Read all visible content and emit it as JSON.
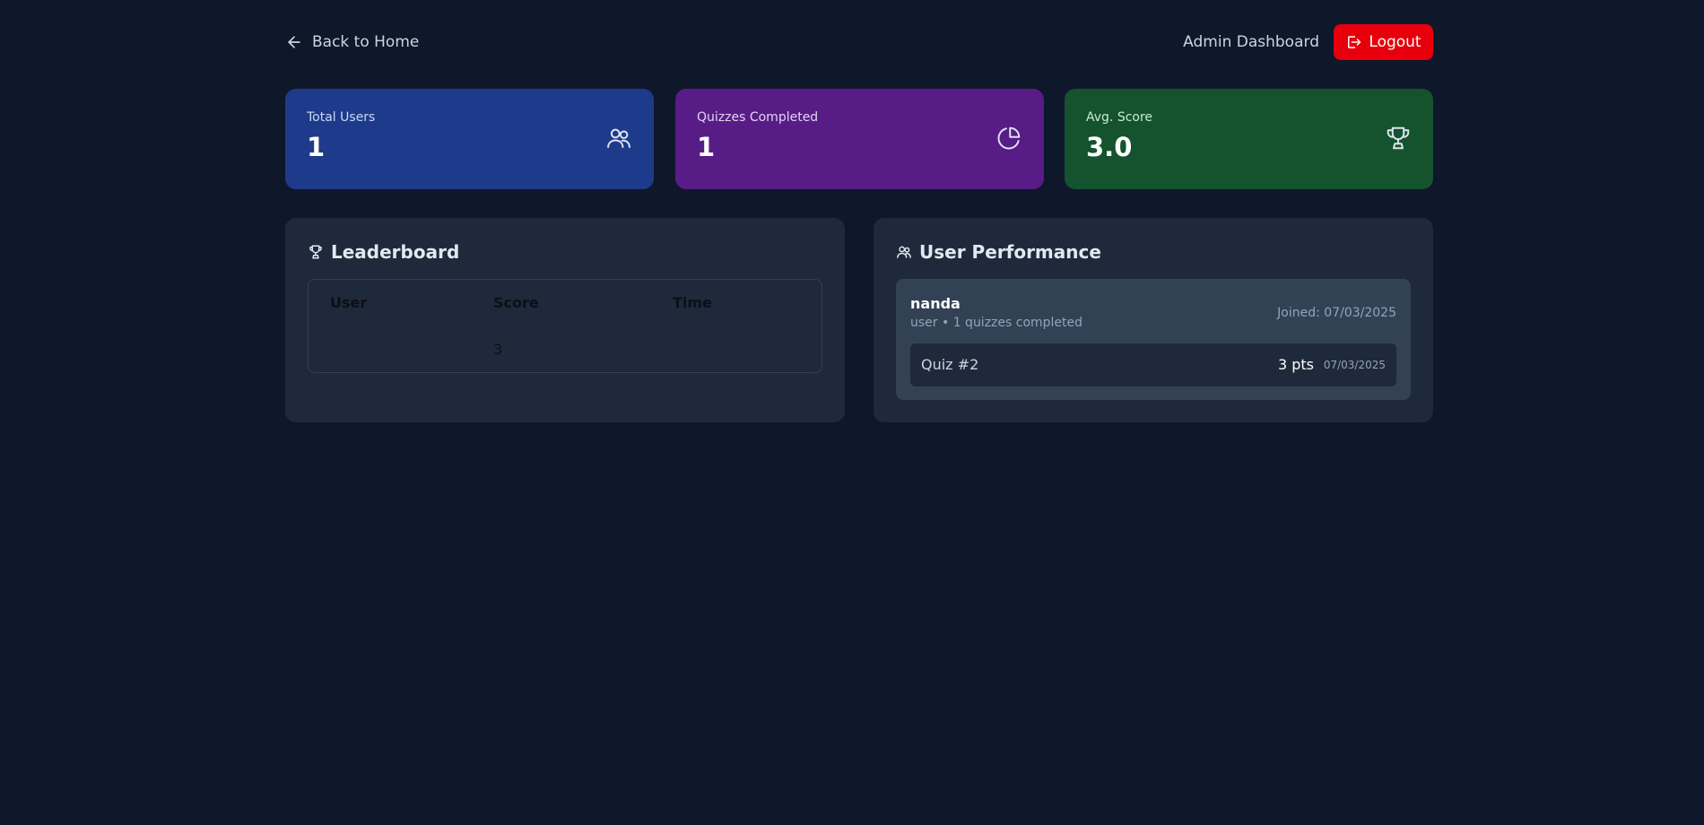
{
  "header": {
    "back_label": "Back to Home",
    "title": "Admin Dashboard",
    "logout_label": "Logout"
  },
  "stats": {
    "total_users": {
      "label": "Total Users",
      "value": "1",
      "icon": "users-icon"
    },
    "quizzes_completed": {
      "label": "Quizzes Completed",
      "value": "1",
      "icon": "pie-chart-icon"
    },
    "avg_score": {
      "label": "Avg. Score",
      "value": "3.0",
      "icon": "trophy-icon"
    }
  },
  "leaderboard": {
    "title": "Leaderboard",
    "columns": [
      "User",
      "Score",
      "Time"
    ],
    "rows": [
      {
        "user": "",
        "score": "3",
        "time": ""
      }
    ]
  },
  "user_performance": {
    "title": "User Performance",
    "users": [
      {
        "name": "nanda",
        "meta": "user • 1 quizzes completed",
        "joined": "Joined: 07/03/2025",
        "quizzes": [
          {
            "name": "Quiz #2",
            "points": "3 pts",
            "date": "07/03/2025"
          }
        ]
      }
    ]
  },
  "colors": {
    "background": "#0f172a",
    "panel": "#1e293b",
    "users_card": "#1e3a8a",
    "quizzes_card": "#581c87",
    "score_card": "#14532d",
    "logout": "#e7000b"
  }
}
